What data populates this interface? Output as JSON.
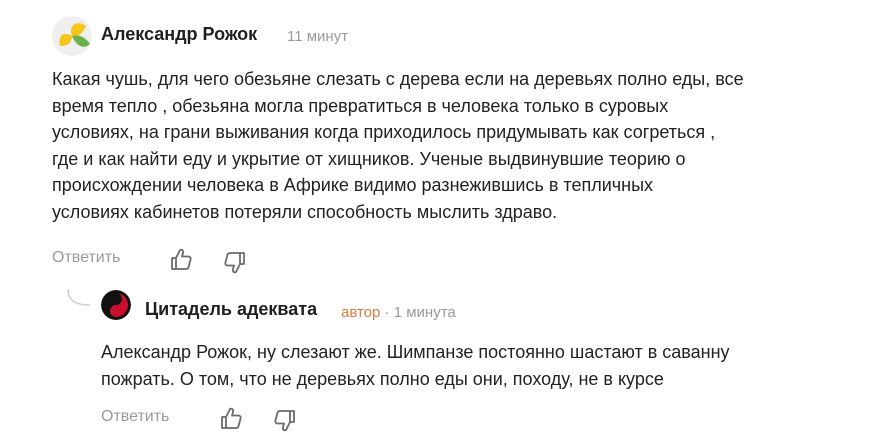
{
  "comments": [
    {
      "author": "Александр Рожок",
      "time": "11 минут",
      "text_lines": [
        "Какая чушь, для чего обезьяне слезать с дерева если на деревьях полно еды, все",
        "время тепло , обезьяна могла превратиться в человека только в суровых",
        "условиях, на грани выживания когда приходилось придумывать как согреться ,",
        "где и как найти еду и укрытие от хищников. Ученые выдвинувшие теорию о",
        "происхождении человека в Африке видимо разнежившись в тепличных",
        "условиях кабинетов потеряли способность мыслить здраво."
      ],
      "reply_label": "Ответить",
      "avatar_icon": "yellow-green-petals-avatar",
      "colors": {
        "petal_yellow": "#f5c518",
        "petal_green": "#6ab04c"
      }
    }
  ],
  "reply": {
    "author": "Цитадель адеквата",
    "author_tag": "автор",
    "separator": "·",
    "time": "1 минута",
    "text_lines": [
      "Александр Рожок, ну слезают же. Шимпанзе постоянно шастают в саванну",
      "пожрать. О том, что не деревьях полно еды они, походу, не в курсе"
    ],
    "reply_label": "Ответить",
    "avatar_icon": "yin-yang-red-black-avatar",
    "colors": {
      "author_tag": "#e07a3f",
      "avatar_red": "#c8102e",
      "avatar_black": "#111111"
    }
  },
  "icons": [
    "thumbs-up-icon",
    "thumbs-down-icon",
    "reply-thread-icon"
  ]
}
